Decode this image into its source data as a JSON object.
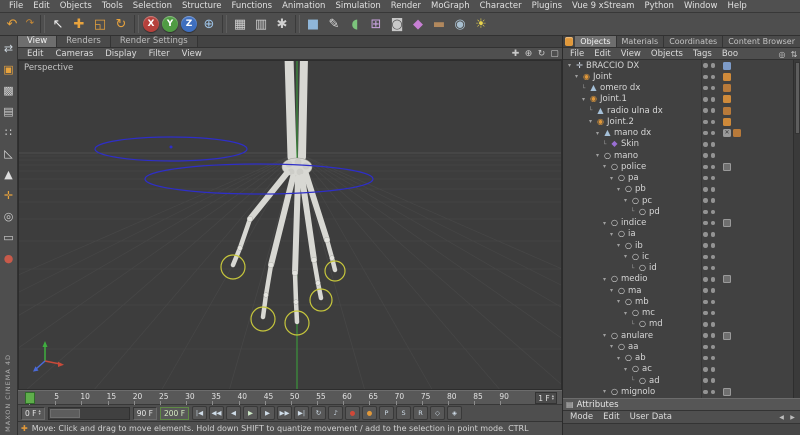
{
  "window": {
    "brand": "MAXON CINEMA 4D"
  },
  "menubar": {
    "items": [
      {
        "name": "menu-file",
        "label": "File"
      },
      {
        "name": "menu-edit",
        "label": "Edit"
      },
      {
        "name": "menu-objects",
        "label": "Objects"
      },
      {
        "name": "menu-tools",
        "label": "Tools"
      },
      {
        "name": "menu-selection",
        "label": "Selection"
      },
      {
        "name": "menu-structure",
        "label": "Structure"
      },
      {
        "name": "menu-functions",
        "label": "Functions"
      },
      {
        "name": "menu-animation",
        "label": "Animation"
      },
      {
        "name": "menu-simulation",
        "label": "Simulation"
      },
      {
        "name": "menu-render",
        "label": "Render"
      },
      {
        "name": "menu-mograph",
        "label": "MoGraph"
      },
      {
        "name": "menu-character",
        "label": "Character"
      },
      {
        "name": "menu-plugins",
        "label": "Plugins"
      },
      {
        "name": "menu-vue-9-xstream",
        "label": "Vue 9 xStream"
      },
      {
        "name": "menu-python",
        "label": "Python"
      },
      {
        "name": "menu-window",
        "label": "Window"
      },
      {
        "name": "menu-help",
        "label": "Help"
      }
    ]
  },
  "toolbar": {
    "icons": [
      {
        "name": "undo-icon",
        "glyph": "↶",
        "color": "#e8a33d"
      },
      {
        "name": "redo-icon",
        "glyph": "↷",
        "color": "#c98a35",
        "cls": "small"
      },
      {
        "name": "toolbar-separator",
        "cls": "sep"
      },
      {
        "name": "live-selection-icon",
        "glyph": "↖",
        "color": "#ececec"
      },
      {
        "name": "move-icon",
        "glyph": "✚",
        "color": "#e8a33d"
      },
      {
        "name": "scale-icon",
        "glyph": "◱",
        "color": "#e8a33d"
      },
      {
        "name": "rotate-icon",
        "glyph": "↻",
        "color": "#e8a33d"
      },
      {
        "name": "toolbar-separator",
        "cls": "sep"
      },
      {
        "name": "lock-x-button",
        "glyph": "X",
        "cls": "circle",
        "bg": "#b5413c"
      },
      {
        "name": "lock-y-button",
        "glyph": "Y",
        "cls": "circle",
        "bg": "#4f9b43"
      },
      {
        "name": "lock-z-button",
        "glyph": "Z",
        "cls": "circle",
        "bg": "#3f6fbf"
      },
      {
        "name": "coordinate-system-icon",
        "glyph": "⊕",
        "color": "#9ec4e8"
      },
      {
        "name": "toolbar-separator",
        "cls": "sep"
      },
      {
        "name": "render-view-icon",
        "glyph": "▦",
        "color": "#cfcfcf"
      },
      {
        "name": "render-picture-viewer-icon",
        "glyph": "▥",
        "color": "#cfcfcf"
      },
      {
        "name": "render-settings-icon",
        "glyph": "✱",
        "color": "#cfcfcf"
      },
      {
        "name": "toolbar-separator",
        "cls": "sep"
      },
      {
        "name": "add-cube-icon",
        "glyph": "■",
        "color": "#8fb6d9"
      },
      {
        "name": "add-spline-icon",
        "glyph": "✎",
        "color": "#dcdcdc"
      },
      {
        "name": "add-nurbs-icon",
        "glyph": "◖",
        "color": "#7cc47c"
      },
      {
        "name": "add-array-icon",
        "glyph": "⊞",
        "color": "#c9a3e0"
      },
      {
        "name": "add-boole-icon",
        "glyph": "◙",
        "color": "#c8c8c8"
      },
      {
        "name": "add-deformer-icon",
        "glyph": "◆",
        "color": "#c77fd4"
      },
      {
        "name": "add-floor-icon",
        "glyph": "▬",
        "color": "#b1885d"
      },
      {
        "name": "add-camera-icon",
        "glyph": "◉",
        "color": "#a8bfd0"
      },
      {
        "name": "add-light-icon",
        "glyph": "☀",
        "color": "#e8d44d"
      }
    ]
  },
  "left_toolbar": {
    "icons": [
      {
        "name": "make-editable-icon",
        "glyph": "⇄",
        "color": "#cfd8e0"
      },
      {
        "name": "model-mode-icon",
        "glyph": "▣",
        "color": "#e8a33d"
      },
      {
        "name": "texture-mode-icon",
        "glyph": "▩",
        "color": "#cfcfcf"
      },
      {
        "name": "workplane-mode-icon",
        "glyph": "▤",
        "color": "#cfcfcf"
      },
      {
        "name": "points-mode-icon",
        "glyph": "∷",
        "color": "#dcdcdc"
      },
      {
        "name": "edges-mode-icon",
        "glyph": "◺",
        "color": "#dcdcdc"
      },
      {
        "name": "polygons-mode-icon",
        "glyph": "▲",
        "color": "#dcdcdc"
      },
      {
        "name": "enable-axis-icon",
        "glyph": "✛",
        "color": "#e8a33d"
      },
      {
        "name": "snap-icon",
        "glyph": "◎",
        "color": "#cfcfcf"
      },
      {
        "name": "workplane-lock-icon",
        "glyph": "▭",
        "color": "#cfcfcf"
      },
      {
        "name": "autokey-icon",
        "glyph": "●",
        "color": "#c85a4a"
      }
    ]
  },
  "viewport": {
    "label": "Perspective",
    "tabs": [
      {
        "name": "tab-view",
        "label": "View",
        "cls": "active"
      },
      {
        "name": "tab-renders",
        "label": "Renders"
      },
      {
        "name": "tab-render-settings",
        "label": "Render Settings"
      }
    ],
    "menu": [
      {
        "name": "vp-menu-edit",
        "label": "Edit"
      },
      {
        "name": "vp-menu-cameras",
        "label": "Cameras"
      },
      {
        "name": "vp-menu-display",
        "label": "Display"
      },
      {
        "name": "vp-menu-filter",
        "label": "Filter"
      },
      {
        "name": "vp-menu-view",
        "label": "View"
      }
    ],
    "view_icons": [
      {
        "name": "pan-view-icon",
        "glyph": "✚"
      },
      {
        "name": "zoom-view-icon",
        "glyph": "⊕"
      },
      {
        "name": "rotate-view-icon",
        "glyph": "↻"
      },
      {
        "name": "toggle-view-icon",
        "glyph": "▢"
      }
    ]
  },
  "timeline": {
    "ticks": [
      {
        "label": "0"
      },
      {
        "label": "5"
      },
      {
        "label": "10"
      },
      {
        "label": "15"
      },
      {
        "label": "20"
      },
      {
        "label": "25"
      },
      {
        "label": "30"
      },
      {
        "label": "35"
      },
      {
        "label": "40"
      },
      {
        "label": "45"
      },
      {
        "label": "50"
      },
      {
        "label": "55"
      },
      {
        "label": "60"
      },
      {
        "label": "65"
      },
      {
        "label": "70"
      },
      {
        "label": "75"
      },
      {
        "label": "80"
      },
      {
        "label": "85"
      },
      {
        "label": "90"
      }
    ],
    "frame_step": "1 F",
    "current": "0 F",
    "end": "90 F",
    "max": "200 F",
    "transport": [
      {
        "name": "goto-start-button",
        "glyph": "|◀"
      },
      {
        "name": "prev-key-button",
        "glyph": "◀◀"
      },
      {
        "name": "prev-frame-button",
        "glyph": "◀"
      },
      {
        "name": "play-button",
        "glyph": "▶",
        "color": "#cde8c6"
      },
      {
        "name": "next-frame-button",
        "glyph": "▶"
      },
      {
        "name": "next-key-button",
        "glyph": "▶▶"
      },
      {
        "name": "goto-end-button",
        "glyph": "▶|"
      },
      {
        "name": "loop-button",
        "glyph": "↻"
      },
      {
        "name": "sound-button",
        "glyph": "♪"
      },
      {
        "name": "record-keyframe-button",
        "glyph": "●",
        "color": "#d04838"
      },
      {
        "name": "autokey-button",
        "glyph": "●",
        "color": "#e0983a"
      },
      {
        "name": "record-position-button",
        "glyph": "P"
      },
      {
        "name": "record-scale-button",
        "glyph": "S"
      },
      {
        "name": "record-rotation-button",
        "glyph": "R"
      },
      {
        "name": "record-parameter-button",
        "glyph": "◇"
      },
      {
        "name": "record-pla-button",
        "glyph": "◈"
      }
    ]
  },
  "objects_panel": {
    "tabs": [
      {
        "name": "tab-objects",
        "label": "Objects",
        "cls": "active"
      },
      {
        "name": "tab-materials",
        "label": "Materials"
      },
      {
        "name": "tab-coordinates",
        "label": "Coordinates"
      },
      {
        "name": "tab-content-browser",
        "label": "Content Browser"
      }
    ],
    "menu": [
      {
        "name": "om-menu-file",
        "label": "File"
      },
      {
        "name": "om-menu-edit",
        "label": "Edit"
      },
      {
        "name": "om-menu-view",
        "label": "View"
      },
      {
        "name": "om-menu-objects",
        "label": "Objects"
      },
      {
        "name": "om-menu-tags",
        "label": "Tags"
      },
      {
        "name": "om-menu-bookmarks",
        "label": "Boo"
      }
    ],
    "menu_icons": [
      {
        "name": "search-icon",
        "glyph": "◎"
      },
      {
        "name": "scroll-to-active-icon",
        "glyph": "⇅"
      }
    ],
    "tree": [
      {
        "name": "tree-row-braccio-dx",
        "label": "BRACCIO DX",
        "depth": 0,
        "exp": "▾",
        "icon": "✛",
        "iconColor": "#cdd6e4",
        "tags": [
          "xpresso"
        ]
      },
      {
        "name": "tree-row-joint",
        "label": "Joint",
        "depth": 1,
        "exp": "▾",
        "icon": "◉",
        "iconColor": "#e0983a",
        "tags": [
          "ik"
        ]
      },
      {
        "name": "tree-row-omero-dx",
        "label": "omero dx",
        "depth": 2,
        "exp": "└",
        "icon": "▲",
        "iconColor": "#a5c0d8",
        "tags": [
          "constraint"
        ]
      },
      {
        "name": "tree-row-joint-1",
        "label": "Joint.1",
        "depth": 2,
        "exp": "▾",
        "icon": "◉",
        "iconColor": "#e0983a",
        "tags": [
          "ik"
        ]
      },
      {
        "name": "tree-row-radio-ulna-dx",
        "label": "radio ulna dx",
        "depth": 3,
        "exp": "└",
        "icon": "▲",
        "iconColor": "#a5c0d8",
        "tags": [
          "constraint"
        ]
      },
      {
        "name": "tree-row-joint-2",
        "label": "Joint.2",
        "depth": 3,
        "exp": "▾",
        "icon": "◉",
        "iconColor": "#e0983a",
        "tags": [
          "ik"
        ]
      },
      {
        "name": "tree-row-mano-dx",
        "label": "mano dx",
        "depth": 4,
        "exp": "▾",
        "icon": "▲",
        "iconColor": "#a5c0d8",
        "tags": [
          "weight",
          "constraint"
        ]
      },
      {
        "name": "tree-row-skin",
        "label": "Skin",
        "depth": 5,
        "exp": "└",
        "icon": "◆",
        "iconColor": "#9a6fd4"
      },
      {
        "name": "tree-row-mano",
        "label": "mano",
        "depth": 4,
        "exp": "▾",
        "icon": "○",
        "iconColor": "#dcdcdc"
      },
      {
        "name": "tree-row-police",
        "label": "police",
        "depth": 5,
        "exp": "▾",
        "icon": "○",
        "iconColor": "#dcdcdc",
        "tags": [
          "ikspline"
        ]
      },
      {
        "name": "tree-row-pa",
        "label": "pa",
        "depth": 6,
        "exp": "▾",
        "icon": "○",
        "iconColor": "#dcdcdc"
      },
      {
        "name": "tree-row-pb",
        "label": "pb",
        "depth": 7,
        "exp": "▾",
        "icon": "○",
        "iconColor": "#dcdcdc"
      },
      {
        "name": "tree-row-pc",
        "label": "pc",
        "depth": 8,
        "exp": "▾",
        "icon": "○",
        "iconColor": "#dcdcdc"
      },
      {
        "name": "tree-row-pd",
        "label": "pd",
        "depth": 9,
        "exp": "└",
        "icon": "○",
        "iconColor": "#dcdcdc"
      },
      {
        "name": "tree-row-indice",
        "label": "indice",
        "depth": 5,
        "exp": "▾",
        "icon": "○",
        "iconColor": "#dcdcdc",
        "tags": [
          "ikspline"
        ]
      },
      {
        "name": "tree-row-ia",
        "label": "ia",
        "depth": 6,
        "exp": "▾",
        "icon": "○",
        "iconColor": "#dcdcdc"
      },
      {
        "name": "tree-row-ib",
        "label": "ib",
        "depth": 7,
        "exp": "▾",
        "icon": "○",
        "iconColor": "#dcdcdc"
      },
      {
        "name": "tree-row-ic",
        "label": "ic",
        "depth": 8,
        "exp": "▾",
        "icon": "○",
        "iconColor": "#dcdcdc"
      },
      {
        "name": "tree-row-id",
        "label": "id",
        "depth": 9,
        "exp": "└",
        "icon": "○",
        "iconColor": "#dcdcdc"
      },
      {
        "name": "tree-row-medio",
        "label": "medio",
        "depth": 5,
        "exp": "▾",
        "icon": "○",
        "iconColor": "#dcdcdc",
        "tags": [
          "ikspline"
        ]
      },
      {
        "name": "tree-row-ma",
        "label": "ma",
        "depth": 6,
        "exp": "▾",
        "icon": "○",
        "iconColor": "#dcdcdc"
      },
      {
        "name": "tree-row-mb",
        "label": "mb",
        "depth": 7,
        "exp": "▾",
        "icon": "○",
        "iconColor": "#dcdcdc"
      },
      {
        "name": "tree-row-mc",
        "label": "mc",
        "depth": 8,
        "exp": "▾",
        "icon": "○",
        "iconColor": "#dcdcdc"
      },
      {
        "name": "tree-row-md",
        "label": "md",
        "depth": 9,
        "exp": "└",
        "icon": "○",
        "iconColor": "#dcdcdc"
      },
      {
        "name": "tree-row-anulare",
        "label": "anulare",
        "depth": 5,
        "exp": "▾",
        "icon": "○",
        "iconColor": "#dcdcdc",
        "tags": [
          "ikspline"
        ]
      },
      {
        "name": "tree-row-aa",
        "label": "aa",
        "depth": 6,
        "exp": "▾",
        "icon": "○",
        "iconColor": "#dcdcdc"
      },
      {
        "name": "tree-row-ab",
        "label": "ab",
        "depth": 7,
        "exp": "▾",
        "icon": "○",
        "iconColor": "#dcdcdc"
      },
      {
        "name": "tree-row-ac",
        "label": "ac",
        "depth": 8,
        "exp": "▾",
        "icon": "○",
        "iconColor": "#dcdcdc"
      },
      {
        "name": "tree-row-ad",
        "label": "ad",
        "depth": 9,
        "exp": "└",
        "icon": "○",
        "iconColor": "#dcdcdc"
      },
      {
        "name": "tree-row-mignolo",
        "label": "mignolo",
        "depth": 5,
        "exp": "▾",
        "icon": "○",
        "iconColor": "#dcdcdc",
        "tags": [
          "ikspline"
        ]
      }
    ]
  },
  "attributes_panel": {
    "title": "Attributes",
    "menu": [
      {
        "name": "attr-menu-mode",
        "label": "Mode"
      },
      {
        "name": "attr-menu-edit",
        "label": "Edit"
      },
      {
        "name": "attr-menu-user-data",
        "label": "User Data"
      }
    ],
    "nav": [
      {
        "name": "back-button",
        "glyph": "◀"
      },
      {
        "name": "forward-button",
        "glyph": "▶"
      }
    ]
  },
  "statusbar": {
    "icon": "✚",
    "text": "Move: Click and drag to move elements. Hold down SHIFT to quantize movement / add to the selection in point mode. CTRL"
  }
}
